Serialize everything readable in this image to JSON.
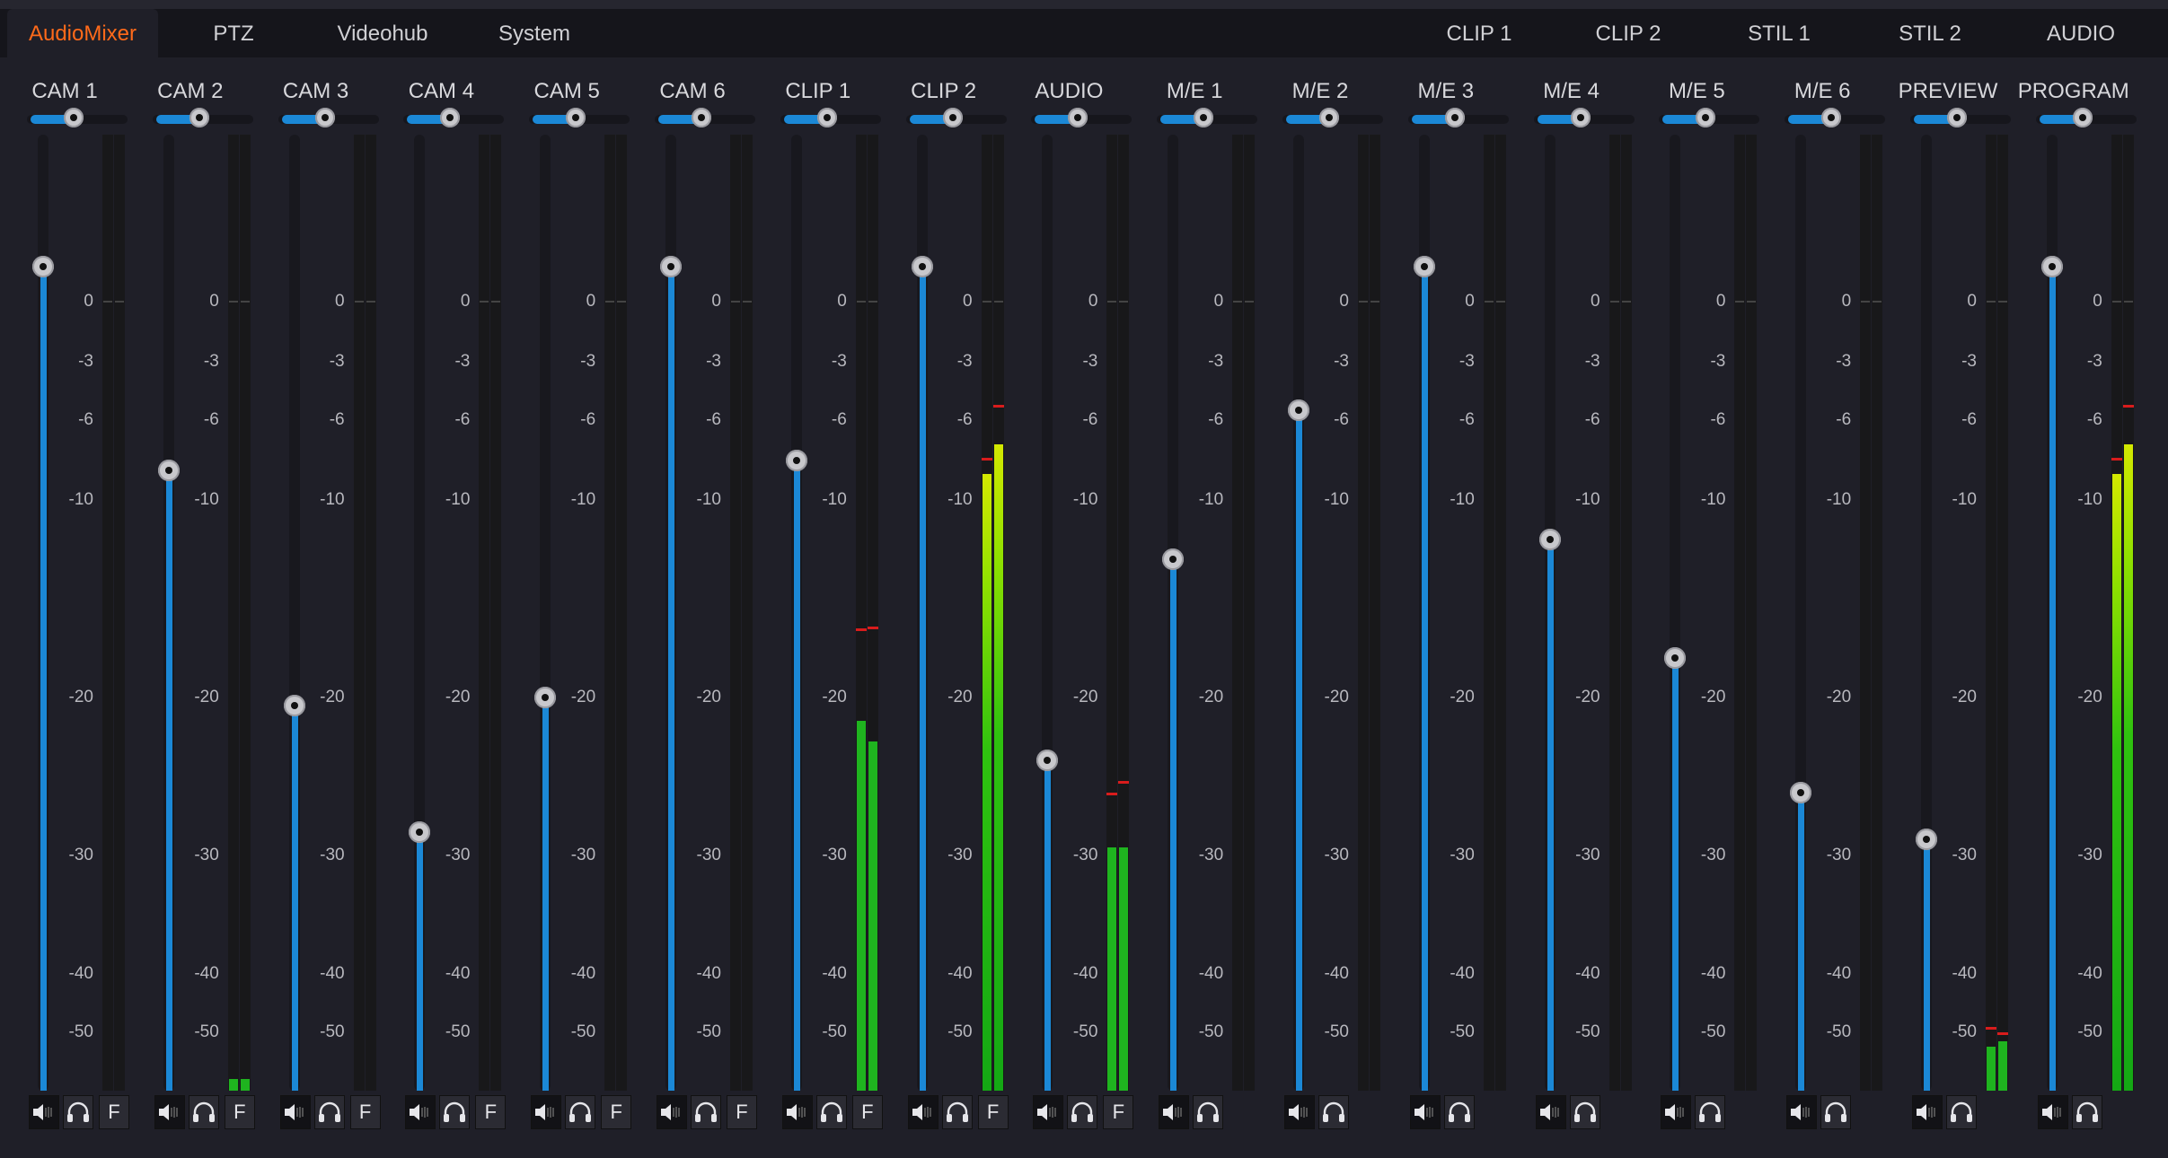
{
  "tabs_left": [
    {
      "label": "AudioMixer",
      "active": true
    },
    {
      "label": "PTZ",
      "active": false
    },
    {
      "label": "Videohub",
      "active": false
    },
    {
      "label": "System",
      "active": false
    }
  ],
  "tabs_right": [
    {
      "label": "CLIP 1"
    },
    {
      "label": "CLIP 2"
    },
    {
      "label": "STIL 1"
    },
    {
      "label": "STIL 2"
    },
    {
      "label": "AUDIO"
    }
  ],
  "scale_labels": [
    "0",
    "-3",
    "-6",
    "-10",
    "-20",
    "-30",
    "-40",
    "-50"
  ],
  "colors": {
    "accent": "#ff6a1a",
    "fader": "#1b88d6",
    "meter_green": "#1fb41f",
    "meter_yellow": "#d4e800",
    "peak": "#d81c1c"
  },
  "channels": [
    {
      "name": "CAM 1",
      "fader_db": 6,
      "pan": 0,
      "meter_db": [
        null,
        null
      ],
      "peak_db": [
        null,
        null
      ],
      "afv": true,
      "icons": [
        "speaker-icon",
        "headphones-icon"
      ],
      "afv_label": "F"
    },
    {
      "name": "CAM 2",
      "fader_db": -8.5,
      "pan": 0,
      "meter_db": [
        -58,
        -58
      ],
      "peak_db": [
        null,
        null
      ],
      "afv": true,
      "afv_label": "F"
    },
    {
      "name": "CAM 3",
      "fader_db": -20.5,
      "pan": 0,
      "meter_db": [
        null,
        null
      ],
      "peak_db": [
        null,
        null
      ],
      "afv": true,
      "afv_label": "F"
    },
    {
      "name": "CAM 4",
      "fader_db": -28.5,
      "pan": 0,
      "meter_db": [
        null,
        null
      ],
      "peak_db": [
        null,
        null
      ],
      "afv": true,
      "afv_label": "F"
    },
    {
      "name": "CAM 5",
      "fader_db": -20,
      "pan": 0,
      "meter_db": [
        null,
        null
      ],
      "peak_db": [
        null,
        null
      ],
      "afv": true,
      "afv_label": "F"
    },
    {
      "name": "CAM 6",
      "fader_db": 6,
      "pan": 0,
      "meter_db": [
        null,
        null
      ],
      "peak_db": [
        null,
        null
      ],
      "afv": true,
      "afv_label": "F"
    },
    {
      "name": "CLIP 1",
      "fader_db": -8,
      "pan": 0,
      "meter_db": [
        -21.5,
        -22.8
      ],
      "peak_db": [
        -16.5,
        -16.4
      ],
      "afv": true,
      "afv_label": "F"
    },
    {
      "name": "CLIP 2",
      "fader_db": 6,
      "pan": 0,
      "meter_db": [
        -8.7,
        -7.2
      ],
      "peak_db": [
        -7.9,
        -5.2
      ],
      "afv": true,
      "afv_label": "F"
    },
    {
      "name": "AUDIO",
      "fader_db": -24,
      "pan": 0,
      "meter_db": [
        -29.5,
        -29.5
      ],
      "peak_db": [
        -26,
        -25.3
      ],
      "afv": true,
      "afv_label": "F"
    },
    {
      "name": "M/E 1",
      "fader_db": -13,
      "pan": 0,
      "meter_db": [
        null,
        null
      ],
      "peak_db": [
        null,
        null
      ],
      "afv": false
    },
    {
      "name": "M/E 2",
      "fader_db": -5.5,
      "pan": 0,
      "meter_db": [
        null,
        null
      ],
      "peak_db": [
        null,
        null
      ],
      "afv": false
    },
    {
      "name": "M/E 3",
      "fader_db": 6,
      "pan": 0,
      "meter_db": [
        null,
        null
      ],
      "peak_db": [
        null,
        null
      ],
      "afv": false
    },
    {
      "name": "M/E 4",
      "fader_db": -12,
      "pan": 0,
      "meter_db": [
        null,
        null
      ],
      "peak_db": [
        null,
        null
      ],
      "afv": false
    },
    {
      "name": "M/E 5",
      "fader_db": -18,
      "pan": 0,
      "meter_db": [
        null,
        null
      ],
      "peak_db": [
        null,
        null
      ],
      "afv": false
    },
    {
      "name": "M/E 6",
      "fader_db": -26,
      "pan": 0,
      "meter_db": [
        null,
        null
      ],
      "peak_db": [
        null,
        null
      ],
      "afv": false
    },
    {
      "name": "PREVIEW",
      "fader_db": -29,
      "pan": 0,
      "meter_db": [
        -52.5,
        -51.5
      ],
      "peak_db": [
        -49,
        -50
      ],
      "afv": false
    },
    {
      "name": "PROGRAM",
      "fader_db": 6,
      "pan": 0,
      "meter_db": [
        -8.7,
        -7.2
      ],
      "peak_db": [
        -7.9,
        -5.2
      ],
      "afv": false
    }
  ]
}
